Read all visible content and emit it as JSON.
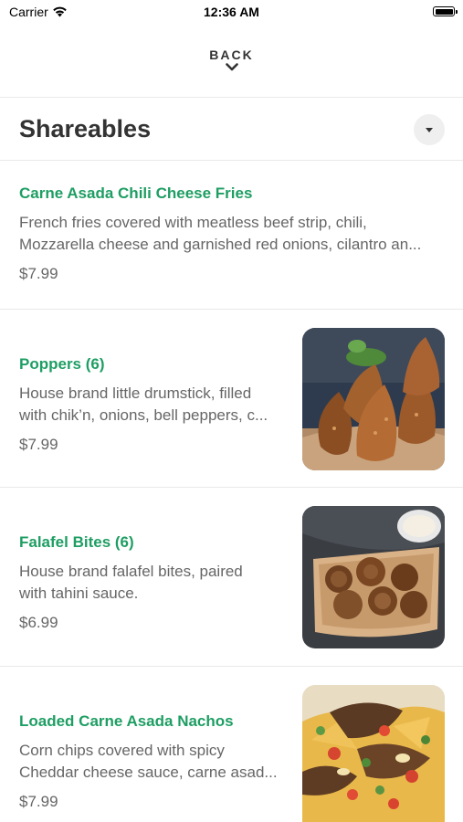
{
  "status_bar": {
    "carrier": "Carrier",
    "time": "12:36 AM",
    "battery_level": 1.0
  },
  "nav": {
    "back_label": "BACK"
  },
  "section": {
    "title": "Shareables"
  },
  "items": [
    {
      "name": "Carne Asada Chili Cheese Fries",
      "desc_line1": "French fries covered with meatless beef strip, chili,",
      "desc_line2": "Mozzarella cheese and garnished red onions, cilantro an...",
      "price": "$7.99",
      "image": false
    },
    {
      "name": "Poppers (6)",
      "desc_line1": "House brand little drumstick, filled",
      "desc_line2": "with chik’n, onions, bell peppers, c...",
      "price": "$7.99",
      "image": true
    },
    {
      "name": "Falafel Bites (6)",
      "desc_line1": "House brand falafel bites, paired",
      "desc_line2": "with tahini sauce.",
      "price": "$6.99",
      "image": true
    },
    {
      "name": "Loaded Carne Asada Nachos",
      "desc_line1": "Corn chips covered with spicy",
      "desc_line2": "Cheddar cheese sauce, carne asad...",
      "price": "$7.99",
      "image": true
    }
  ],
  "colors": {
    "accent": "#1e9e63",
    "text": "#333333",
    "muted": "#666666",
    "divider": "#e9e9e9"
  },
  "icons": {
    "wifi": "wifi-icon",
    "battery": "battery-icon",
    "back": "chevron-down-icon",
    "dropdown": "caret-down-icon"
  }
}
